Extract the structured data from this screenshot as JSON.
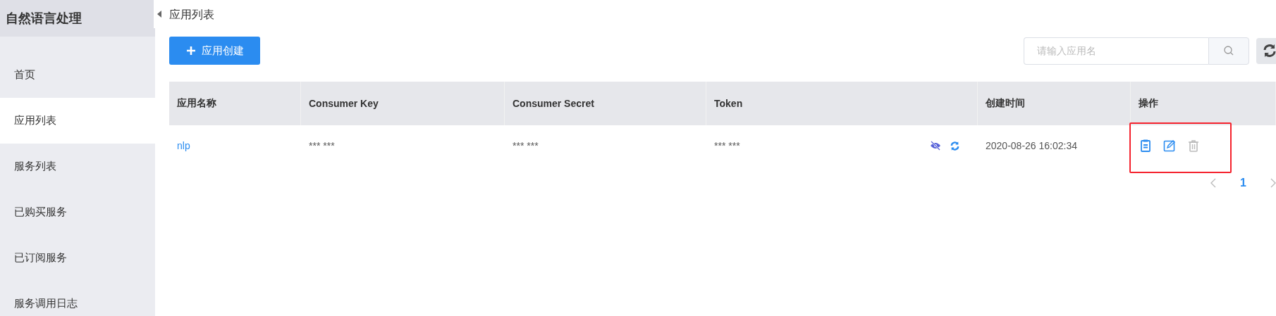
{
  "sidebar": {
    "title": "自然语言处理",
    "items": [
      {
        "label": "首页",
        "selected": false
      },
      {
        "label": "应用列表",
        "selected": true
      },
      {
        "label": "服务列表",
        "selected": false
      },
      {
        "label": "已购买服务",
        "selected": false
      },
      {
        "label": "已订阅服务",
        "selected": false
      },
      {
        "label": "服务调用日志",
        "selected": false
      }
    ]
  },
  "page_title": "应用列表",
  "create_button": "应用创建",
  "search": {
    "placeholder": "请输入应用名"
  },
  "table": {
    "columns": [
      "应用名称",
      "Consumer Key",
      "Consumer Secret",
      "Token",
      "创建时间",
      "操作"
    ],
    "rows": [
      {
        "name": "nlp",
        "consumer_key": "*** ***",
        "consumer_secret": "*** ***",
        "token": "*** ***",
        "created": "2020-08-26 16:02:34",
        "actions_highlighted": true,
        "actions": [
          {
            "kind": "view",
            "disabled": false
          },
          {
            "kind": "edit",
            "disabled": false
          },
          {
            "kind": "delete",
            "disabled": true
          }
        ]
      }
    ]
  },
  "pagination": {
    "pages": [
      {
        "label": "1",
        "selected": true
      }
    ]
  }
}
